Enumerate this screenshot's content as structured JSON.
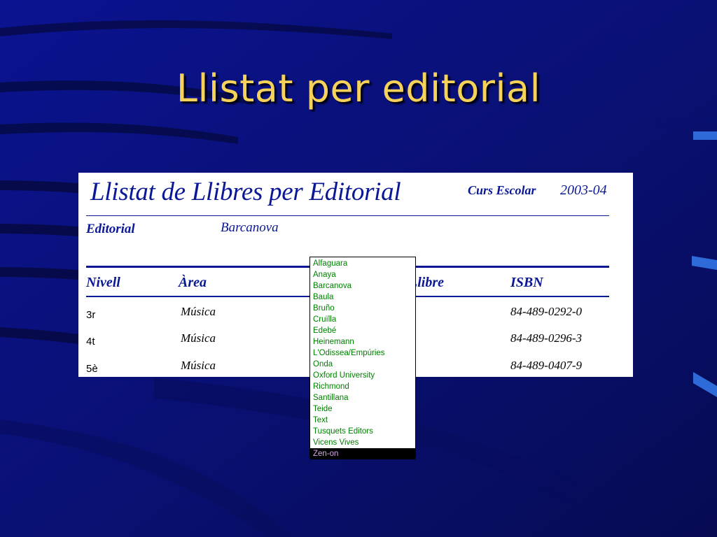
{
  "slide": {
    "title": "Llistat per editorial"
  },
  "report": {
    "title": "Llistat de Llibres per Editorial",
    "school_year_label": "Curs Escolar",
    "school_year": "2003-04",
    "editorial_label": "Editorial",
    "editorial_value": "Barcanova",
    "columns": [
      "Nivell",
      "Àrea",
      "Llibre",
      "ISBN"
    ],
    "rows": [
      {
        "nivell": "3r",
        "area": "Música",
        "isbn": "84-489-0292-0"
      },
      {
        "nivell": "4t",
        "area": "Música",
        "isbn": "84-489-0296-3"
      },
      {
        "nivell": "5è",
        "area": "Música",
        "isbn": "84-489-0407-9"
      }
    ]
  },
  "editorial_dropdown": {
    "options": [
      "Alfaguara",
      "Anaya",
      "Barcanova",
      "Baula",
      "Bruño",
      "Cruïlla",
      "Edebé",
      "Heinemann",
      "L'Odissea/Empúries",
      "Onda",
      "Oxford University",
      "Richmond",
      "Santillana",
      "Teide",
      "Text",
      "Tusquets Editors",
      "Vicens Vives",
      "Zen-on"
    ],
    "selected": "Zen-on"
  },
  "colors": {
    "background": "#0a0f7a",
    "title": "#f7d25a",
    "report_text": "#0b1896",
    "option_text": "#008000",
    "selected_bg": "#000000",
    "selected_text": "#d8a8e8"
  }
}
